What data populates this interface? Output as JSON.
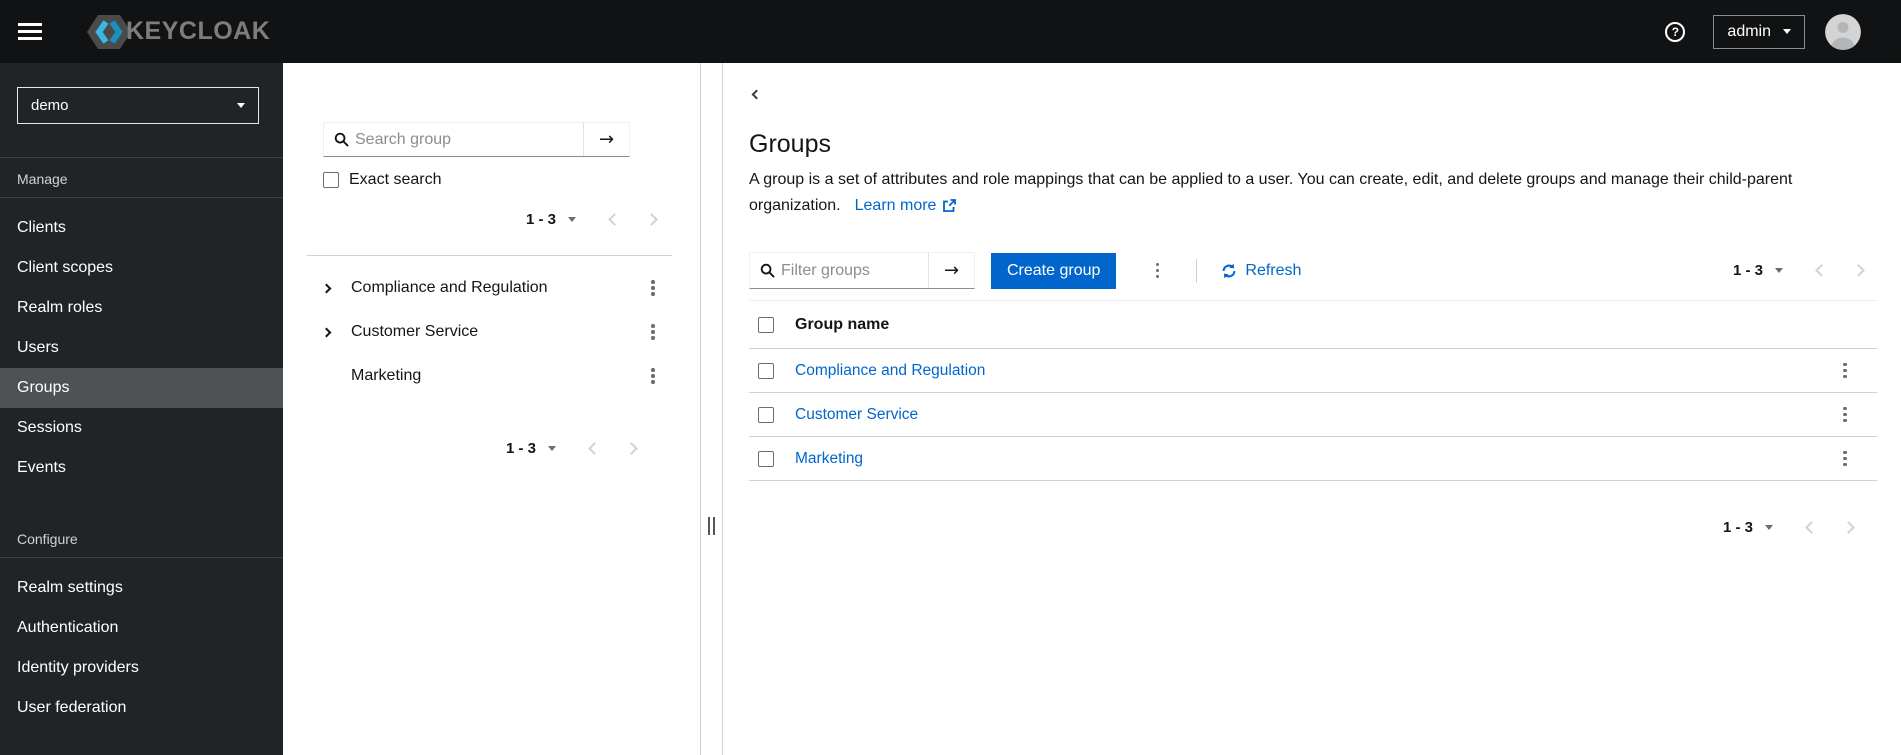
{
  "masthead": {
    "brand_text": "KEYCLOAK",
    "user_menu_label": "admin"
  },
  "sidebar": {
    "realm": "demo",
    "sections": [
      {
        "title": "Manage",
        "items": [
          {
            "label": "Clients"
          },
          {
            "label": "Client scopes"
          },
          {
            "label": "Realm roles"
          },
          {
            "label": "Users"
          },
          {
            "label": "Groups",
            "active": true
          },
          {
            "label": "Sessions"
          },
          {
            "label": "Events"
          }
        ]
      },
      {
        "title": "Configure",
        "items": [
          {
            "label": "Realm settings"
          },
          {
            "label": "Authentication"
          },
          {
            "label": "Identity providers"
          },
          {
            "label": "User federation"
          }
        ]
      }
    ]
  },
  "tree_panel": {
    "search_placeholder": "Search group",
    "exact_search_label": "Exact search",
    "pagination_range": "1 - 3",
    "items": [
      {
        "name": "Compliance and Regulation",
        "expandable": true
      },
      {
        "name": "Customer Service",
        "expandable": true
      },
      {
        "name": "Marketing",
        "expandable": false
      }
    ]
  },
  "main": {
    "title": "Groups",
    "description": "A group is a set of attributes and role mappings that can be applied to a user. You can create, edit, and delete groups and manage their child-parent organization.",
    "learn_more_label": "Learn more",
    "toolbar": {
      "filter_placeholder": "Filter groups",
      "create_button_label": "Create group",
      "refresh_label": "Refresh",
      "pagination_range": "1 - 3"
    },
    "table": {
      "column_header": "Group name",
      "rows": [
        {
          "name": "Compliance and Regulation"
        },
        {
          "name": "Customer Service"
        },
        {
          "name": "Marketing"
        }
      ]
    },
    "bottom_pagination_range": "1 - 3"
  },
  "icons": {
    "hamburger": "bars",
    "help": "question-circle",
    "dropdown_caret": "chevron-down",
    "avatar": "user",
    "search": "magnifier",
    "search_submit": "arrow-right",
    "tree_expand": "chevron-right",
    "kebab": "vertical-ellipsis",
    "pagination_prev": "chevron-left",
    "pagination_next": "chevron-right",
    "back": "chevron-left",
    "learn_more": "external-link",
    "refresh": "sync"
  },
  "colors": {
    "primary": "#0066cc",
    "link": "#0066cc",
    "masthead_bg": "#111214",
    "sidebar_bg": "#212427",
    "sidebar_active_bg": "#4f5255",
    "logo_cyan": "#36b9e5",
    "text": "#151515",
    "muted": "#6a6e73",
    "border": "#d2d2d2",
    "disabled": "#d2d2d2"
  }
}
